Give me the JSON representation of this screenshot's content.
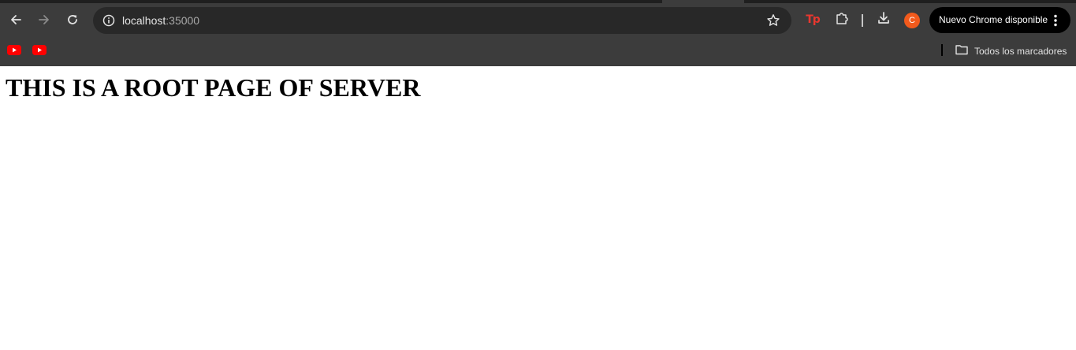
{
  "browser": {
    "url_host": "localhost",
    "url_port": ":35000",
    "profile_initial": "C",
    "update_label": "Nuevo Chrome disponible",
    "extension_logo_text": "Tp",
    "icons": {
      "back": "arrow-left-icon",
      "forward": "arrow-right-icon",
      "reload": "reload-icon",
      "site_info": "info-icon",
      "bookmark": "star-icon",
      "extensions": "puzzle-icon",
      "downloads": "download-icon",
      "menu": "vertical-dots-icon",
      "folder": "folder-icon",
      "youtube": "youtube-icon"
    },
    "colors": {
      "chrome_bg": "#3c3c3c",
      "omnibox_bg": "#282828",
      "avatar_bg": "#f25a1c",
      "extension_logo": "#e8372f",
      "youtube_red": "#ff0000"
    }
  },
  "bookmarks_bar": {
    "all_bookmarks_label": "Todos los marcadores"
  },
  "page": {
    "heading": "THIS IS A ROOT PAGE OF SERVER"
  }
}
